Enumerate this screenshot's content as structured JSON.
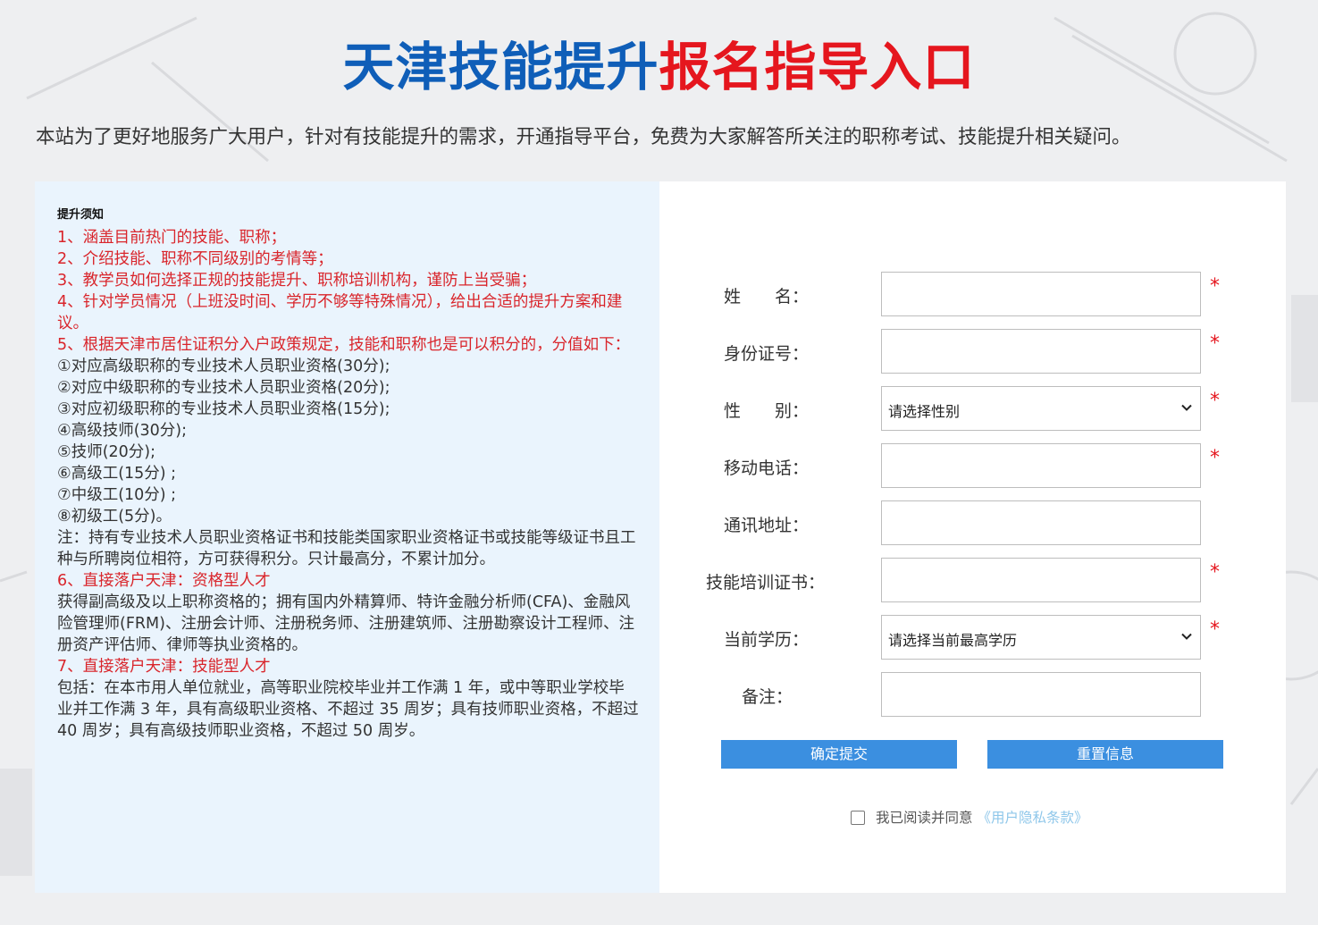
{
  "page": {
    "title_blue": "天津技能提升",
    "title_red": "报名指导入口",
    "intro": "本站为了更好地服务广大用户，针对有技能提升的需求，开通指导平台，免费为大家解答所关注的职称考试、技能提升相关疑问。"
  },
  "notice": {
    "heading": "提升须知",
    "lines": [
      {
        "style": "red",
        "text": "1、涵盖目前热门的技能、职称；"
      },
      {
        "style": "red",
        "text": "2、介绍技能、职称不同级别的考情等；"
      },
      {
        "style": "red",
        "text": "3、教学员如何选择正规的技能提升、职称培训机构，谨防上当受骗；"
      },
      {
        "style": "red",
        "text": "4、针对学员情况（上班没时间、学历不够等特殊情况），给出合适的提升方案和建议。"
      },
      {
        "style": "red",
        "text": "5、根据天津市居住证积分入户政策规定，技能和职称也是可以积分的，分值如下："
      },
      {
        "style": "dark",
        "text": "①对应高级职称的专业技术人员职业资格(30分);"
      },
      {
        "style": "dark",
        "text": "②对应中级职称的专业技术人员职业资格(20分);"
      },
      {
        "style": "dark",
        "text": "③对应初级职称的专业技术人员职业资格(15分);"
      },
      {
        "style": "dark",
        "text": "④高级技师(30分);"
      },
      {
        "style": "dark",
        "text": "⑤技师(20分);"
      },
      {
        "style": "dark",
        "text": "⑥高级工(15分) ;"
      },
      {
        "style": "dark",
        "text": "⑦中级工(10分) ;"
      },
      {
        "style": "dark",
        "text": "⑧初级工(5分)。"
      },
      {
        "style": "dark",
        "text": "注：持有专业技术人员职业资格证书和技能类国家职业资格证书或技能等级证书且工种与所聘岗位相符，方可获得积分。只计最高分，不累计加分。"
      },
      {
        "style": "red",
        "text": "6、直接落户天津：资格型人才"
      },
      {
        "style": "dark",
        "text": "获得副高级及以上职称资格的；拥有国内外精算师、特许金融分析师(CFA)、金融风险管理师(FRM)、注册会计师、注册税务师、注册建筑师、注册勘察设计工程师、注册资产评估师、律师等执业资格的。"
      },
      {
        "style": "red",
        "text": "7、直接落户天津：技能型人才"
      },
      {
        "style": "dark",
        "text": "包括：在本市用人单位就业，高等职业院校毕业并工作满 1 年，或中等职业学校毕业并工作满 3 年，具有高级职业资格、不超过 35 周岁；具有技师职业资格，不超过 40 周岁；具有高级技师职业资格，不超过 50 周岁。"
      }
    ]
  },
  "form": {
    "name_label": "姓　　名：",
    "id_label": "身份证号：",
    "gender_label": "性　　别：",
    "gender_selected": "请选择性别",
    "phone_label": "移动电话：",
    "address_label": "通讯地址：",
    "cert_label": "技能培训证书：",
    "edu_label": "当前学历：",
    "edu_selected": "请选择当前最高学历",
    "remark_label": "备注：",
    "required_mark": "*",
    "submit_label": "确定提交",
    "reset_label": "重置信息",
    "agree_text": "我已阅读并同意",
    "privacy_link": "《用户隐私条款》"
  }
}
